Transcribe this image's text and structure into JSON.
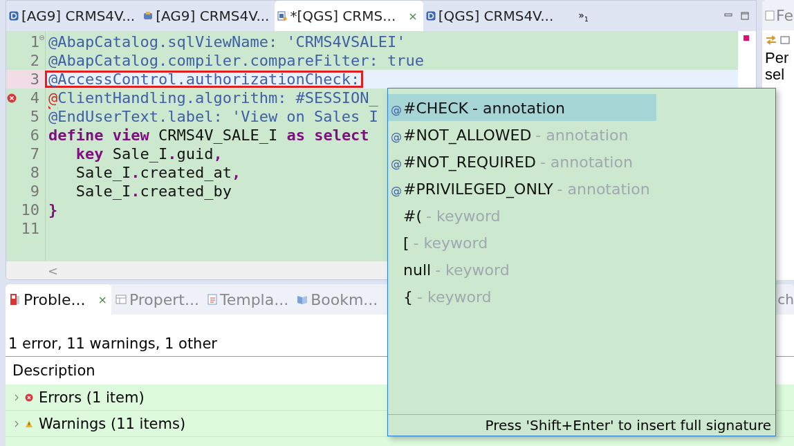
{
  "editor": {
    "tabs": [
      {
        "label": "[AG9] CRMS4V...",
        "kind": "ddic",
        "selected": false
      },
      {
        "label": "[AG9] CRMS4V...",
        "kind": "class",
        "selected": false
      },
      {
        "label": "*[QGS] CRMS...",
        "kind": "cds",
        "selected": true,
        "close": "×"
      },
      {
        "label": "[QGS] CRMS4V...",
        "kind": "ddic",
        "selected": false
      }
    ],
    "overflow": {
      "glyph": "»",
      "count": "1"
    },
    "lines": [
      {
        "number": "1",
        "fold": true,
        "current": false,
        "error": false,
        "tokens": [
          {
            "kind": "annotation",
            "text": "@AbapCatalog.sqlViewName: 'CRMS4VSALEI'"
          }
        ]
      },
      {
        "number": "2",
        "fold": false,
        "current": false,
        "error": false,
        "tokens": [
          {
            "kind": "annotation",
            "text": "@AbapCatalog.compiler.compareFilter: true"
          }
        ]
      },
      {
        "number": "3",
        "fold": false,
        "current": true,
        "error": false,
        "tokens": [
          {
            "kind": "annotation",
            "text": "@AccessControl.authorizationCheck:"
          }
        ]
      },
      {
        "number": "4",
        "fold": false,
        "current": false,
        "error": true,
        "tokens": [
          {
            "kind": "squiggle",
            "text": "@"
          },
          {
            "kind": "annotation",
            "text": "ClientHandling.algorithm: #SESSION_"
          }
        ]
      },
      {
        "number": "5",
        "fold": false,
        "current": false,
        "error": false,
        "tokens": [
          {
            "kind": "annotation",
            "text": "@EndUserText.label: 'View on Sales I"
          }
        ]
      },
      {
        "number": "6",
        "fold": false,
        "current": false,
        "error": false,
        "tokens": [
          {
            "kind": "keyword",
            "text": "define "
          },
          {
            "kind": "keyword",
            "text": "view"
          },
          {
            "kind": "plain",
            "text": " CRMS4V_SALE_I "
          },
          {
            "kind": "keyword",
            "text": "as "
          },
          {
            "kind": "keyword",
            "text": "select"
          }
        ]
      },
      {
        "number": "7",
        "fold": false,
        "current": false,
        "error": false,
        "tokens": [
          {
            "kind": "keyword",
            "text": "   key"
          },
          {
            "kind": "plain",
            "text": " Sale_I"
          },
          {
            "kind": "punct",
            "text": "."
          },
          {
            "kind": "plain",
            "text": "guid"
          },
          {
            "kind": "punct",
            "text": ","
          }
        ]
      },
      {
        "number": "8",
        "fold": false,
        "current": false,
        "error": false,
        "tokens": [
          {
            "kind": "plain",
            "text": "   Sale_I"
          },
          {
            "kind": "punct",
            "text": "."
          },
          {
            "kind": "plain",
            "text": "created_at"
          },
          {
            "kind": "punct",
            "text": ","
          }
        ]
      },
      {
        "number": "9",
        "fold": false,
        "current": false,
        "error": false,
        "tokens": [
          {
            "kind": "plain",
            "text": "   Sale_I"
          },
          {
            "kind": "punct",
            "text": "."
          },
          {
            "kind": "plain",
            "text": "created_by"
          }
        ]
      },
      {
        "number": "10",
        "fold": false,
        "current": false,
        "error": false,
        "tokens": [
          {
            "kind": "punct",
            "text": "}"
          }
        ]
      },
      {
        "number": "11",
        "fold": false,
        "current": false,
        "error": false
      }
    ],
    "scroll_left": "<"
  },
  "completion": {
    "items": [
      {
        "kind": "annotation",
        "prefix": "@",
        "label": "#CHECK",
        "desc": "- annotation",
        "selected": true
      },
      {
        "kind": "annotation",
        "prefix": "@",
        "label": "#NOT_ALLOWED",
        "desc": "- annotation",
        "selected": false
      },
      {
        "kind": "annotation",
        "prefix": "@",
        "label": "#NOT_REQUIRED",
        "desc": "- annotation",
        "selected": false
      },
      {
        "kind": "annotation",
        "prefix": "@",
        "label": "#PRIVILEGED_ONLY",
        "desc": "- annotation",
        "selected": false
      },
      {
        "kind": "keyword",
        "label": "#(",
        "desc": "- keyword",
        "selected": false
      },
      {
        "kind": "keyword",
        "label": "[",
        "desc": "- keyword",
        "selected": false
      },
      {
        "kind": "keyword",
        "label": "null",
        "desc": "- keyword",
        "selected": false
      },
      {
        "kind": "keyword",
        "label": "{",
        "desc": "- keyword",
        "selected": false
      }
    ],
    "footer": "Press 'Shift+Enter' to insert full signature"
  },
  "bottom_panel": {
    "tabs": [
      {
        "label": "Proble...",
        "kind": "problems",
        "selected": true,
        "close": "×"
      },
      {
        "label": "Propert...",
        "kind": "properties",
        "selected": false
      },
      {
        "label": "Templa...",
        "kind": "templates",
        "selected": false
      },
      {
        "label": "Bookm...",
        "kind": "bookmarks",
        "selected": false
      }
    ],
    "cut_tab": "ch",
    "summary": "1 error, 11 warnings, 1 other",
    "columns": [
      "Description"
    ],
    "rows": [
      {
        "kind": "error",
        "label": "Errors (1 item)",
        "expanded": false
      },
      {
        "kind": "warning",
        "label": "Warnings (11 items)",
        "expanded": false
      }
    ]
  },
  "side_panel": {
    "tab": "Fe",
    "text_lines": [
      "Per",
      "sel"
    ]
  }
}
